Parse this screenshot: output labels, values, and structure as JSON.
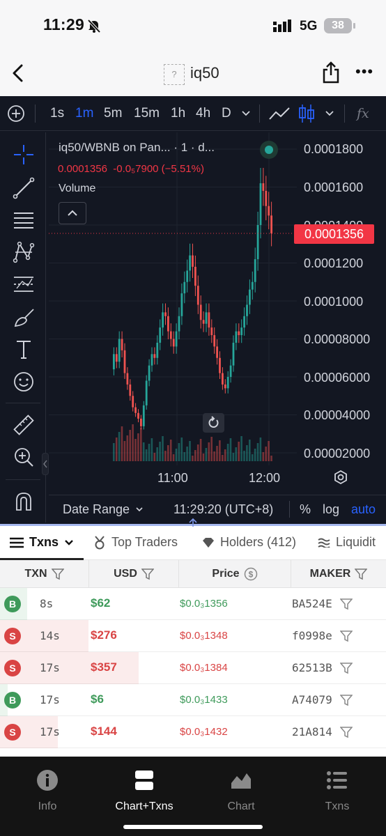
{
  "status_bar": {
    "time": "11:29",
    "network": "5G",
    "battery": "38"
  },
  "header": {
    "token_icon_placeholder": "?",
    "title": "iq50"
  },
  "toolbar": {
    "intervals": [
      "1s",
      "1m",
      "5m",
      "15m",
      "1h",
      "4h",
      "D"
    ],
    "active_interval": "1m",
    "indicator_label": "fx"
  },
  "chart": {
    "legend_title": "iq50/WBNB on Pan... · 1 · d...",
    "legend_price": "0.0001356",
    "legend_change": "-0.0₅7900 (−5.51%)",
    "volume_label": "Volume",
    "current_price": "0.0001356",
    "price_ticks": [
      "0.0001800",
      "0.0001600",
      "0.0001400",
      "0.0001200",
      "0.0001000",
      "0.00008000",
      "0.00006000",
      "0.00004000",
      "0.00002000"
    ],
    "time_ticks": [
      "11:00",
      "12:00"
    ],
    "up_color": "#26a69a",
    "down_color": "#ef5350"
  },
  "chart_bottom": {
    "date_range": "Date Range",
    "clock": "11:29:20 (UTC+8)",
    "percent": "%",
    "log": "log",
    "auto": "auto"
  },
  "tabs": {
    "txns": "Txns",
    "top_traders": "Top Traders",
    "holders": "Holders (412)",
    "liquidity": "Liquidit"
  },
  "table": {
    "headers": {
      "txn": "TXN",
      "usd": "USD",
      "price": "Price",
      "maker": "MAKER"
    },
    "rows": [
      {
        "side": "B",
        "age": "8s",
        "usd": "$62",
        "price": "$0.0₃1356",
        "maker": "BA524E",
        "fill": 0.07
      },
      {
        "side": "S",
        "age": "14s",
        "usd": "$276",
        "price": "$0.0₃1348",
        "maker": "f0998e",
        "fill": 0.23
      },
      {
        "side": "S",
        "age": "17s",
        "usd": "$357",
        "price": "$0.0₃1384",
        "maker": "62513B",
        "fill": 0.36
      },
      {
        "side": "B",
        "age": "17s",
        "usd": "$6",
        "price": "$0.0₃1433",
        "maker": "A74079",
        "fill": 0.02
      },
      {
        "side": "S",
        "age": "17s",
        "usd": "$144",
        "price": "$0.0₃1432",
        "maker": "21A814",
        "fill": 0.15
      }
    ]
  },
  "bottom_nav": {
    "info": "Info",
    "chart_txns": "Chart+Txns",
    "chart": "Chart",
    "txns": "Txns"
  }
}
